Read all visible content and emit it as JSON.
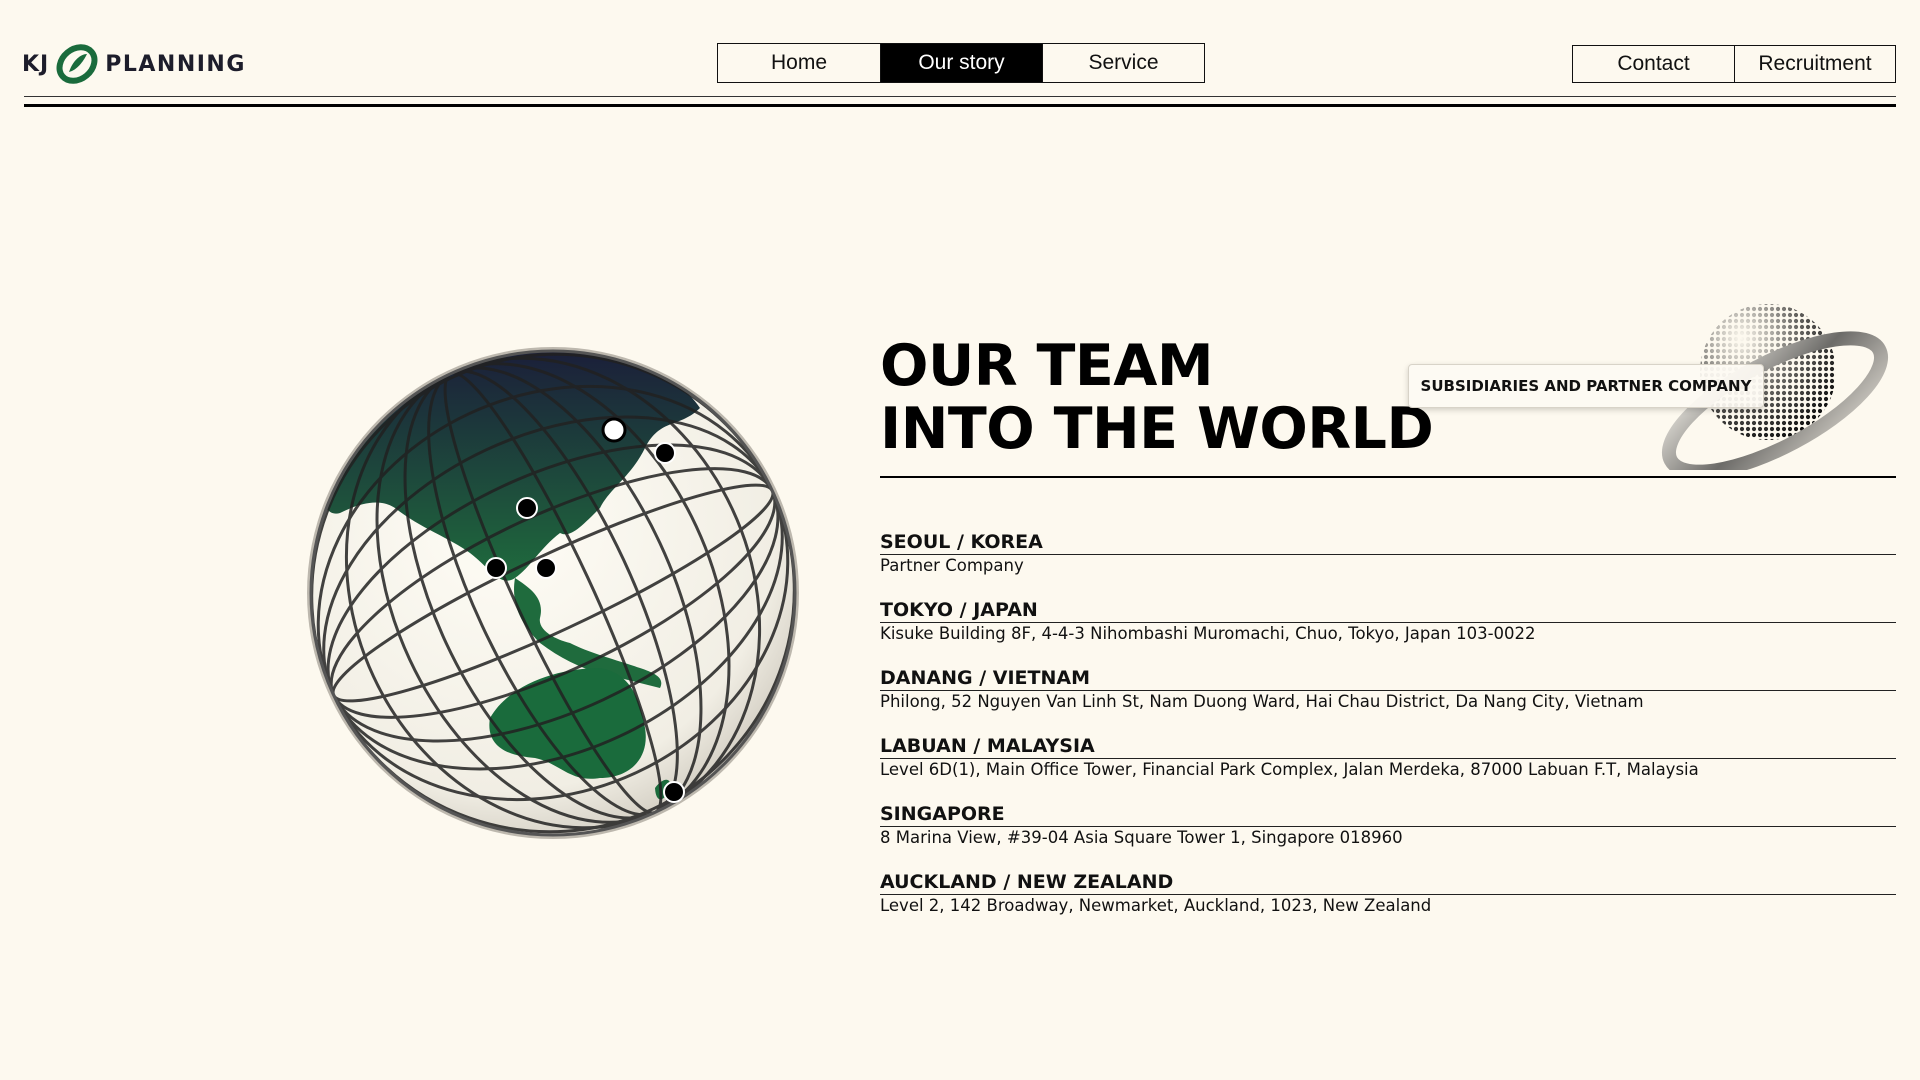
{
  "brand": {
    "prefix": "KJ",
    "name": "PLANNING",
    "logo_icon": "kj-leaf-logo-icon",
    "accent_color": "#1a6b3c"
  },
  "nav": {
    "center": [
      {
        "label": "Home",
        "active": false
      },
      {
        "label": "Our story",
        "active": true
      },
      {
        "label": "Service",
        "active": false
      }
    ],
    "right": [
      {
        "label": "Contact"
      },
      {
        "label": "Recruitment"
      }
    ]
  },
  "hero": {
    "title_line1": "OUR TEAM",
    "title_line2": "INTO THE WORLD",
    "badge": "SUBSIDIARIES AND PARTNER COMPANY"
  },
  "locations": [
    {
      "city": "SEOUL / KOREA",
      "address": "Partner Company"
    },
    {
      "city": "TOKYO / JAPAN",
      "address": "Kisuke Building 8F, 4-4-3 Nihombashi Muromachi, Chuo, Tokyo, Japan 103-0022"
    },
    {
      "city": "DANANG / VIETNAM",
      "address": "Philong, 52 Nguyen Van Linh St, Nam Duong Ward, Hai Chau District, Da Nang City, Vietnam"
    },
    {
      "city": "LABUAN / MALAYSIA",
      "address": "Level 6D(1), Main Office Tower, Financial Park Complex, Jalan Merdeka, 87000 Labuan F.T, Malaysia"
    },
    {
      "city": "SINGAPORE",
      "address": "8 Marina View, #39-04 Asia Square Tower 1, Singapore 018960"
    },
    {
      "city": "AUCKLAND / NEW ZEALAND",
      "address": "Level 2, 142 Broadway, Newmarket, Auckland, 1023, New Zealand"
    }
  ],
  "colors": {
    "background": "#fdf9ef",
    "land": "#1a6b3c",
    "ink": "#000000"
  }
}
